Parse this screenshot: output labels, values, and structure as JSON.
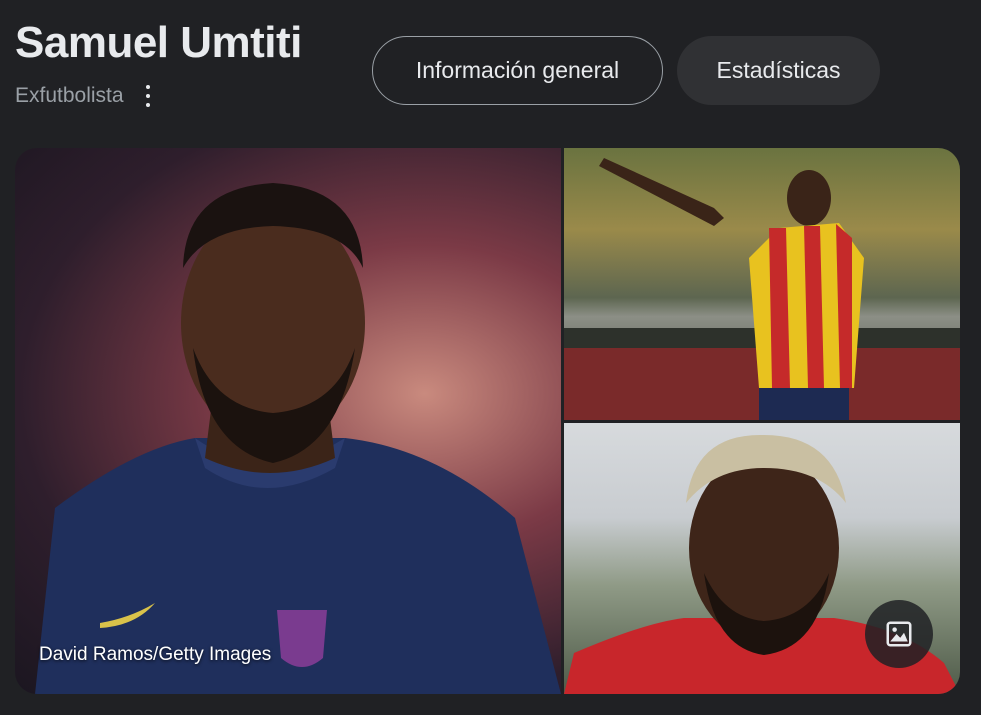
{
  "header": {
    "title": "Samuel Umtiti",
    "subtitle": "Exfutbolista",
    "more_icon": "more-vert-icon"
  },
  "tabs": [
    {
      "label": "Información general",
      "active": true
    },
    {
      "label": "Estadísticas",
      "active": false
    }
  ],
  "images": {
    "main": {
      "credit": "David Ramos/Getty Images"
    },
    "button_icon": "image-icon"
  },
  "colors": {
    "background": "#202124",
    "text": "#e8eaed",
    "muted": "#9aa0a6",
    "tab_bg": "#303134"
  }
}
